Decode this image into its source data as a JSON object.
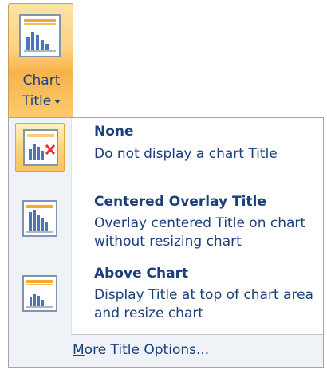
{
  "ribbon": {
    "button_line1": "Chart",
    "button_line2": "Title",
    "icon": "chart-title-icon"
  },
  "menu": {
    "items": [
      {
        "title": "None",
        "description": "Do not display a chart Title",
        "icon": "chart-no-title-icon",
        "selected": true
      },
      {
        "title": "Centered Overlay Title",
        "description": "Overlay centered Title on chart without resizing chart",
        "icon": "chart-overlay-title-icon",
        "selected": false
      },
      {
        "title": "Above Chart",
        "description": "Display Title at top of chart area and resize chart",
        "icon": "chart-above-title-icon",
        "selected": false
      }
    ],
    "more_options": {
      "access_key": "M",
      "label_rest": "ore Title Options..."
    }
  },
  "colors": {
    "text": "#1a3f7a",
    "ribbon_highlight": "#f8b34a",
    "title_bar": "#f7a92c",
    "chart_bars": "#4a77b4",
    "delete_x": "#e43131"
  }
}
